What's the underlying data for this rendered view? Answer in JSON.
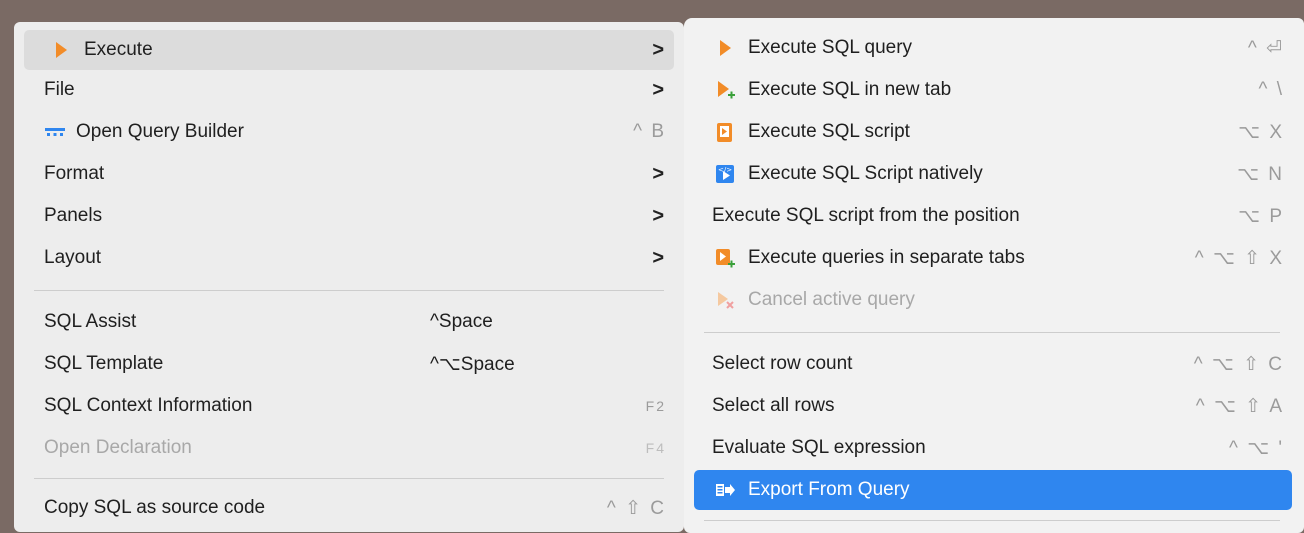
{
  "main_menu": [
    {
      "label": "Execute",
      "has_submenu": true,
      "icon": "play-icon"
    },
    {
      "label": "File",
      "has_submenu": true
    },
    {
      "label": "Open Query Builder",
      "shortcut": "^ B",
      "icon": "query-builder-icon"
    },
    {
      "label": "Format",
      "has_submenu": true
    },
    {
      "label": "Panels",
      "has_submenu": true
    },
    {
      "label": "Layout",
      "has_submenu": true
    },
    {
      "label": "SQL Assist",
      "shortcut": "^Space"
    },
    {
      "label": "SQL Template",
      "shortcut": "^⌥Space"
    },
    {
      "label": "SQL Context Information",
      "shortcut": "F2"
    },
    {
      "label": "Open Declaration",
      "shortcut": "F4",
      "disabled": true
    },
    {
      "label": "Copy SQL as source code",
      "shortcut": "^ ⇧ C"
    }
  ],
  "submenu_arrow": ">",
  "execute_submenu": [
    {
      "label": "Execute SQL query",
      "shortcut": "^ ⏎",
      "icon": "play-icon"
    },
    {
      "label": "Execute SQL in new tab",
      "shortcut": "^ \\",
      "icon": "play-new-tab-icon"
    },
    {
      "label": "Execute SQL script",
      "shortcut": "⌥ X",
      "icon": "script-icon"
    },
    {
      "label": "Execute SQL Script natively",
      "shortcut": "⌥ N",
      "icon": "native-script-icon"
    },
    {
      "label": "Execute SQL script from the position",
      "shortcut": "⌥ P"
    },
    {
      "label": "Execute queries in separate tabs",
      "shortcut": "^ ⌥ ⇧ X",
      "icon": "separate-tabs-icon"
    },
    {
      "label": "Cancel active query",
      "disabled": true,
      "icon": "cancel-query-icon"
    },
    {
      "label": "Select row count",
      "shortcut": "^ ⌥ ⇧ C"
    },
    {
      "label": "Select all rows",
      "shortcut": "^ ⌥ ⇧ A"
    },
    {
      "label": "Evaluate SQL expression",
      "shortcut": "^ ⌥ '"
    },
    {
      "label": "Export From Query",
      "highlighted": true,
      "icon": "export-icon"
    }
  ],
  "colors": {
    "accent": "#2f86ef",
    "play": "#f28c28",
    "menu_bg": "#ededed",
    "disabled": "#a8a8a8"
  }
}
